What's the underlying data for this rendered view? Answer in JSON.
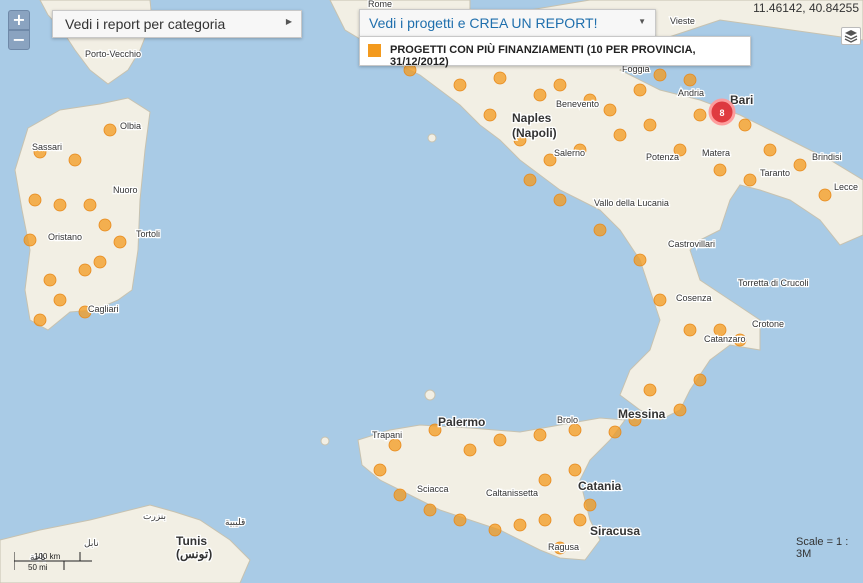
{
  "controls": {
    "zoom_in": "+",
    "zoom_out": "−",
    "report_category_label": "Vedi i report per categoria",
    "project_select_label": "Vedi i progetti e CREA UN REPORT!",
    "coordinates": "11.46142, 40.84255",
    "scale_label": "Scale = 1 : 3M",
    "scalebar_km": "100 km",
    "scalebar_mi": "50 mi"
  },
  "legend": {
    "label": "PROGETTI CON PIÙ FINANZIAMENTI (10 PER PROVINCIA, 31/12/2012)",
    "color": "#f39a1e"
  },
  "colors": {
    "sea": "#a9cbe6",
    "land": "#f2efe4",
    "marker": "#f39a1e",
    "selected_marker": "#d9262e"
  },
  "selected_marker_label": "8",
  "places": [
    {
      "name": "Rome",
      "cls": "lab-sm"
    },
    {
      "name": "Vieste",
      "cls": "lab-sm"
    },
    {
      "name": "Foggia",
      "cls": "lab-sm"
    },
    {
      "name": "Porto-Vecchio",
      "cls": "lab-sm"
    },
    {
      "name": "Olbia",
      "cls": "lab-sm"
    },
    {
      "name": "Sassari",
      "cls": "lab-sm"
    },
    {
      "name": "Nuoro",
      "cls": "lab-sm"
    },
    {
      "name": "Oristano",
      "cls": "lab-sm"
    },
    {
      "name": "Tortoli",
      "cls": "lab-sm"
    },
    {
      "name": "Cagliari",
      "cls": "lab-sm"
    },
    {
      "name": "Benevento",
      "cls": "lab-sm"
    },
    {
      "name": "Naples",
      "cls": "lab-big"
    },
    {
      "name": "(Napoli)",
      "cls": "lab-big"
    },
    {
      "name": "Salerno",
      "cls": "lab-sm"
    },
    {
      "name": "Andria",
      "cls": "lab-sm"
    },
    {
      "name": "Bari",
      "cls": "lab-big"
    },
    {
      "name": "Potenza",
      "cls": "lab-sm"
    },
    {
      "name": "Matera",
      "cls": "lab-sm"
    },
    {
      "name": "Brindisi",
      "cls": "lab-sm"
    },
    {
      "name": "Taranto",
      "cls": "lab-sm"
    },
    {
      "name": "Lecce",
      "cls": "lab-sm"
    },
    {
      "name": "Vallo della Lucania",
      "cls": "lab-sm"
    },
    {
      "name": "Castrovillari",
      "cls": "lab-sm"
    },
    {
      "name": "Torretta di Crucoli",
      "cls": "lab-sm"
    },
    {
      "name": "Cosenza",
      "cls": "lab-sm"
    },
    {
      "name": "Crotone",
      "cls": "lab-sm"
    },
    {
      "name": "Catanzaro",
      "cls": "lab-sm"
    },
    {
      "name": "Palermo",
      "cls": "lab-big"
    },
    {
      "name": "Trapani",
      "cls": "lab-sm"
    },
    {
      "name": "Brolo",
      "cls": "lab-sm"
    },
    {
      "name": "Messina",
      "cls": "lab-big"
    },
    {
      "name": "Sciacca",
      "cls": "lab-sm"
    },
    {
      "name": "Caltanissetta",
      "cls": "lab-sm"
    },
    {
      "name": "Catania",
      "cls": "lab-big"
    },
    {
      "name": "Siracusa",
      "cls": "lab-big"
    },
    {
      "name": "Ragusa",
      "cls": "lab-sm"
    },
    {
      "name": "Tunis",
      "cls": "lab-big"
    },
    {
      "name": "(تونس)",
      "cls": "lab-big"
    },
    {
      "name": "بنزرت",
      "cls": "lab-sm"
    },
    {
      "name": "نابل",
      "cls": "lab-sm"
    },
    {
      "name": "قليبية",
      "cls": "lab-sm"
    },
    {
      "name": "باجة",
      "cls": "lab-sm"
    }
  ]
}
